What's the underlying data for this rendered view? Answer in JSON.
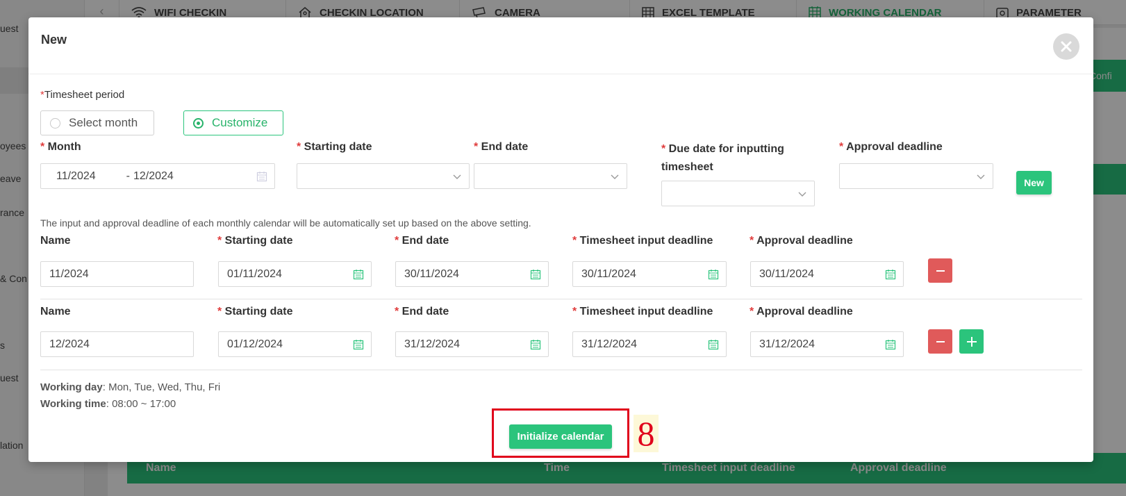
{
  "background": {
    "tabs": [
      {
        "label": "WIFI CHECKIN",
        "icon": "wifi-icon"
      },
      {
        "label": "CHECKIN LOCATION",
        "icon": "location-person-icon"
      },
      {
        "label": "CAMERA",
        "icon": "camera-icon"
      },
      {
        "label": "EXCEL TEMPLATE",
        "icon": "table-icon"
      },
      {
        "label": "WORKING CALENDAR",
        "icon": "calendar-icon",
        "active": true
      },
      {
        "label": "PARAMETER",
        "icon": "settings-icon"
      }
    ],
    "sidebar_items": [
      "uest",
      "oyees",
      "eave",
      "rance",
      "& Con",
      "s",
      "uest",
      "lation"
    ],
    "config_button": "Confi",
    "table_headers": [
      "Name",
      "Time",
      "Timesheet input deadline",
      "Approval deadline"
    ]
  },
  "modal": {
    "title": "New",
    "timesheet_period_label": "Timesheet period",
    "period_options": [
      "Select month",
      "Customize"
    ],
    "selected_period": "Customize",
    "setup": {
      "month_label": "Month",
      "month_from": "11/2024",
      "month_separator": "-",
      "month_to": "12/2024",
      "starting_date_label": "Starting date",
      "end_date_label": "End date",
      "due_date_label_line1": "Due date for inputting",
      "due_date_label_line2": "timesheet",
      "approval_deadline_label": "Approval deadline",
      "new_button": "New"
    },
    "note": "The input and approval deadline of each monthly calendar will be automatically set up based on the above setting.",
    "row_labels": {
      "name": "Name",
      "starting_date": "Starting date",
      "end_date": "End date",
      "timesheet_input_deadline": "Timesheet input deadline",
      "approval_deadline": "Approval deadline"
    },
    "rows": [
      {
        "name": "11/2024",
        "starting_date": "01/11/2024",
        "end_date": "30/11/2024",
        "timesheet_input_deadline": "30/11/2024",
        "approval_deadline": "30/11/2024"
      },
      {
        "name": "12/2024",
        "starting_date": "01/12/2024",
        "end_date": "31/12/2024",
        "timesheet_input_deadline": "31/12/2024",
        "approval_deadline": "31/12/2024"
      }
    ],
    "working_day_label": "Working day",
    "working_day_value": ": Mon, Tue, Wed, Thu, Fri",
    "working_time_label": "Working time",
    "working_time_value": ": 08:00 ~ 17:00",
    "initialize_button": "Initialize calendar"
  },
  "annotation": {
    "step_number": "8"
  },
  "colors": {
    "accent": "#2bc47c",
    "danger": "#e05a5a",
    "required": "#e03c3c",
    "annotation": "#e0001b"
  }
}
